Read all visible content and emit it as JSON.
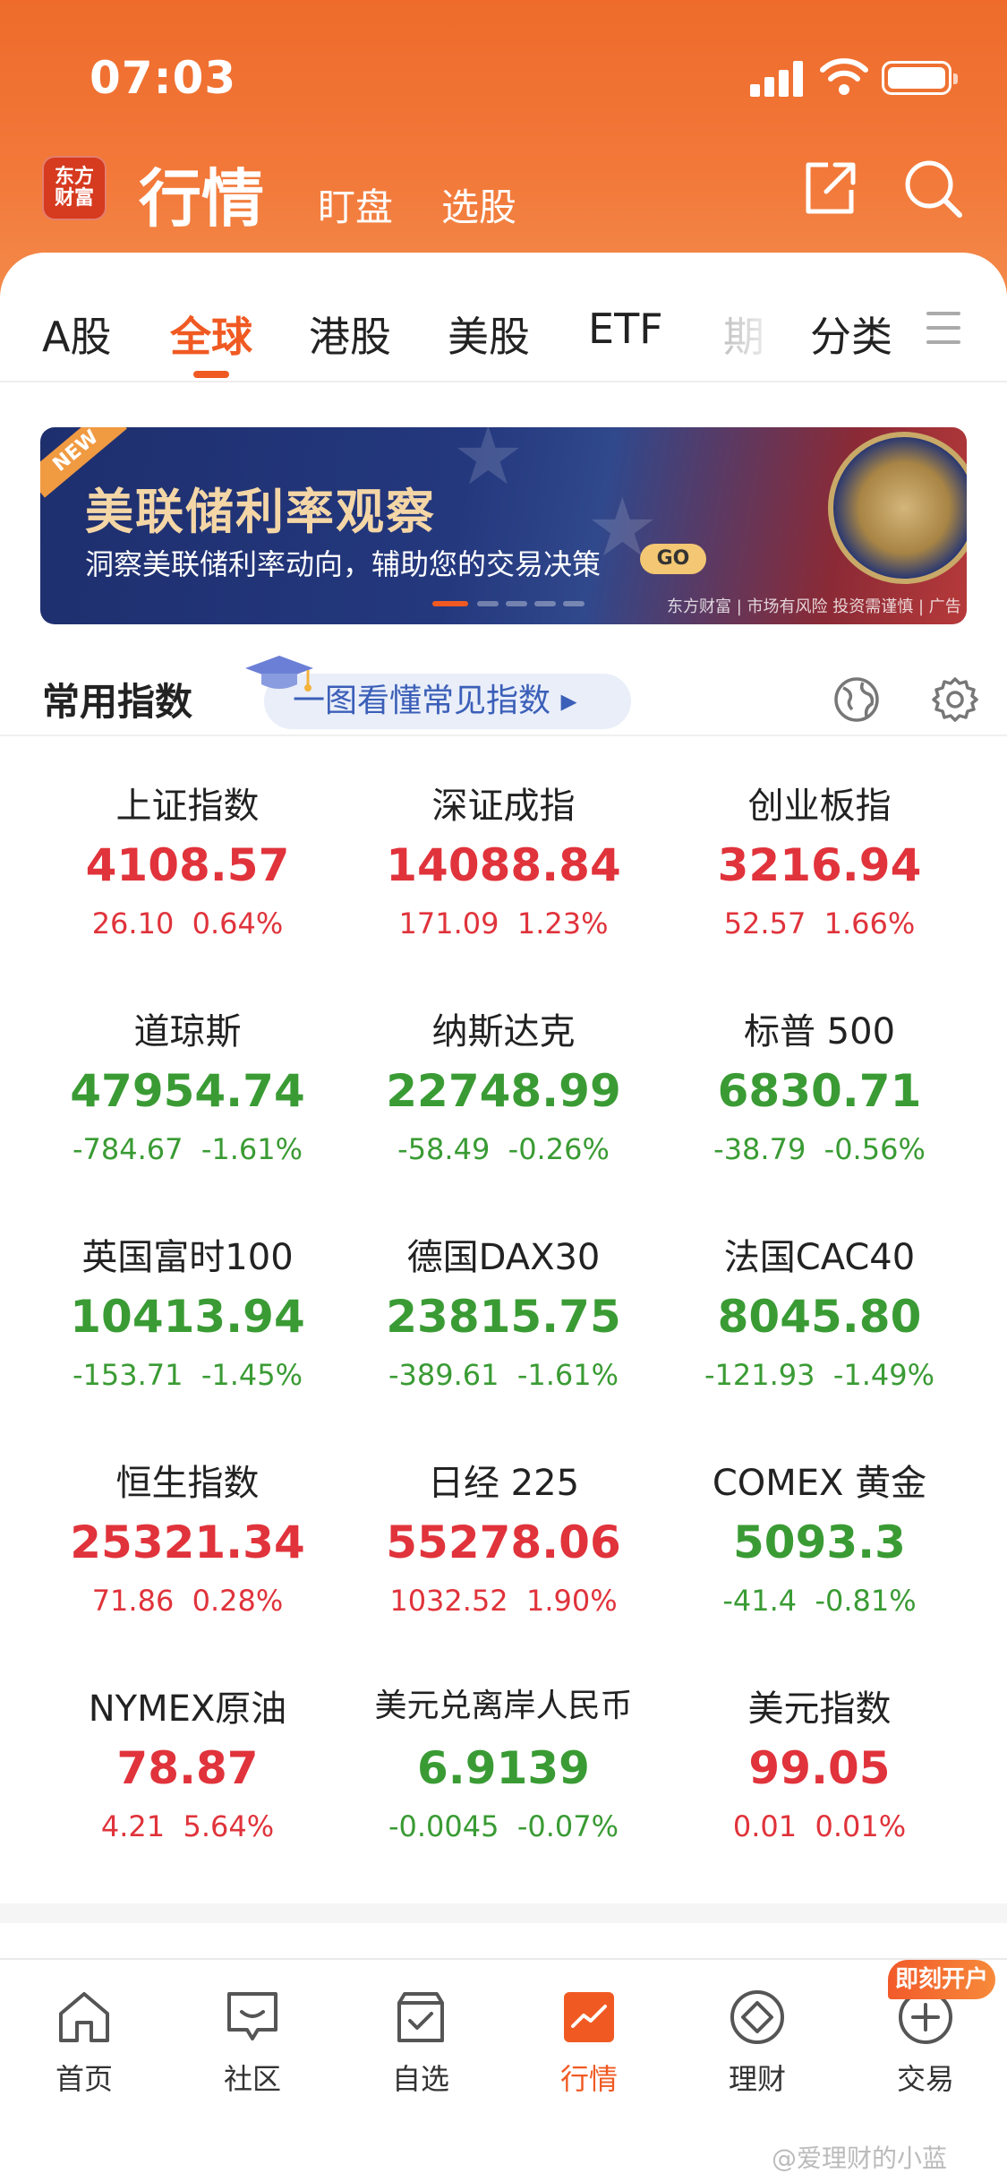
{
  "status": {
    "time": "07:03"
  },
  "header": {
    "logo_line1": "东方",
    "logo_line2": "财富",
    "title": "行情",
    "sub_tabs": [
      "盯盘",
      "选股"
    ]
  },
  "tabs": [
    "A股",
    "全球",
    "港股",
    "美股",
    "ETF",
    "期",
    "分类"
  ],
  "banner": {
    "tag": "NEW",
    "title": "美联储利率观察",
    "subtitle": "洞察美联储利率动向，辅助您的交易决策",
    "go": "GO",
    "footer": "东方财富 | 市场有风险 投资需谨慎 | 广告"
  },
  "section": {
    "title": "常用指数",
    "guide": "一图看懂常见指数 ▸"
  },
  "indices": [
    {
      "name": "上证指数",
      "value": "4108.57",
      "change": "26.10",
      "pct": "0.64%",
      "dir": "up"
    },
    {
      "name": "深证成指",
      "value": "14088.84",
      "change": "171.09",
      "pct": "1.23%",
      "dir": "up"
    },
    {
      "name": "创业板指",
      "value": "3216.94",
      "change": "52.57",
      "pct": "1.66%",
      "dir": "up"
    },
    {
      "name": "道琼斯",
      "value": "47954.74",
      "change": "-784.67",
      "pct": "-1.61%",
      "dir": "down"
    },
    {
      "name": "纳斯达克",
      "value": "22748.99",
      "change": "-58.49",
      "pct": "-0.26%",
      "dir": "down"
    },
    {
      "name": "标普 500",
      "value": "6830.71",
      "change": "-38.79",
      "pct": "-0.56%",
      "dir": "down"
    },
    {
      "name": "英国富时100",
      "value": "10413.94",
      "change": "-153.71",
      "pct": "-1.45%",
      "dir": "down"
    },
    {
      "name": "德国DAX30",
      "value": "23815.75",
      "change": "-389.61",
      "pct": "-1.61%",
      "dir": "down"
    },
    {
      "name": "法国CAC40",
      "value": "8045.80",
      "change": "-121.93",
      "pct": "-1.49%",
      "dir": "down"
    },
    {
      "name": "恒生指数",
      "value": "25321.34",
      "change": "71.86",
      "pct": "0.28%",
      "dir": "up"
    },
    {
      "name": "日经 225",
      "value": "55278.06",
      "change": "1032.52",
      "pct": "1.90%",
      "dir": "up"
    },
    {
      "name": "COMEX 黄金",
      "value": "5093.3",
      "change": "-41.4",
      "pct": "-0.81%",
      "dir": "down"
    },
    {
      "name": "NYMEX原油",
      "value": "78.87",
      "change": "4.21",
      "pct": "5.64%",
      "dir": "up"
    },
    {
      "name": "美元兑离岸人民币",
      "value": "6.9139",
      "change": "-0.0045",
      "pct": "-0.07%",
      "dir": "down"
    },
    {
      "name": "美元指数",
      "value": "99.05",
      "change": "0.01",
      "pct": "0.01%",
      "dir": "up"
    }
  ],
  "nav": [
    {
      "label": "首页",
      "icon": "home-icon"
    },
    {
      "label": "社区",
      "icon": "chat-icon"
    },
    {
      "label": "自选",
      "icon": "checklist-icon"
    },
    {
      "label": "行情",
      "icon": "chart-icon"
    },
    {
      "label": "理财",
      "icon": "diamond-icon"
    },
    {
      "label": "交易",
      "icon": "plus-icon"
    }
  ],
  "nav_badge": "即刻开户",
  "watermark": "@爱理财的小蓝",
  "colors": {
    "accent": "#f05a22",
    "up": "#e0333b",
    "down": "#3a9b34",
    "header": "#ee6b2b"
  }
}
